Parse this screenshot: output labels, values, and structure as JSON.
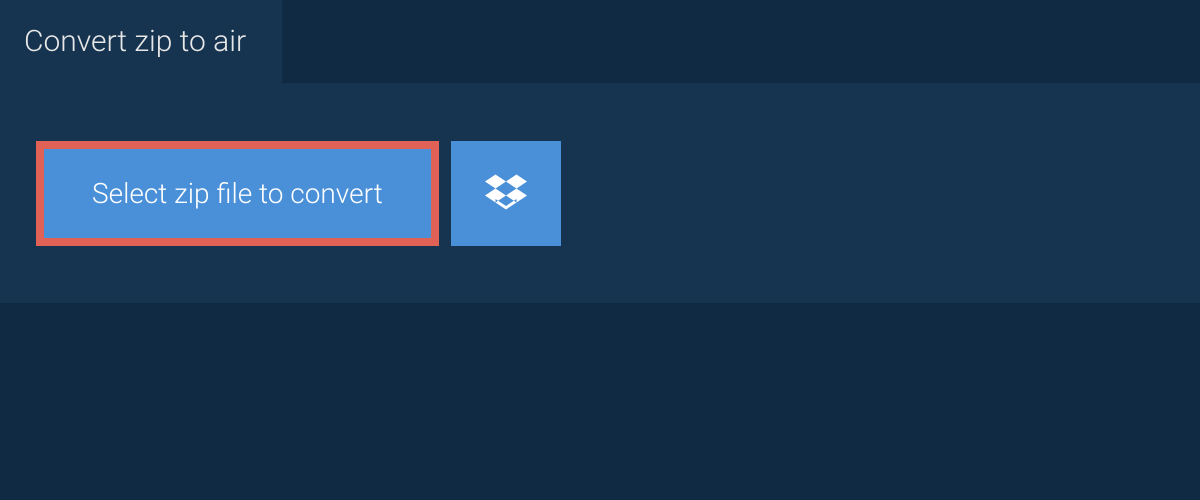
{
  "tab": {
    "title": "Convert zip to air"
  },
  "actions": {
    "select_file_label": "Select zip file to convert"
  },
  "colors": {
    "page_bg": "#0f2a42",
    "panel_bg": "#163450",
    "button_bg": "#4a90d9",
    "button_border": "#e06257",
    "text_light": "#e8e8e8",
    "text_white": "#ffffff"
  }
}
